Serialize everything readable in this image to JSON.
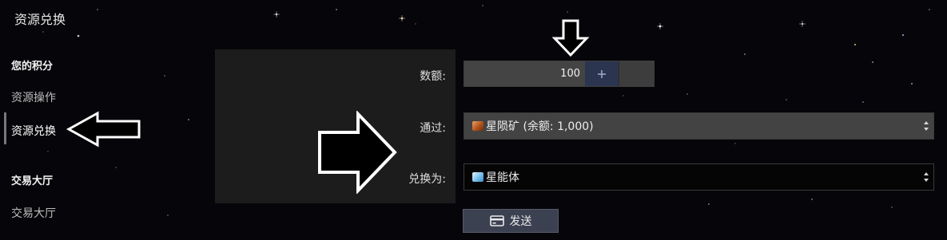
{
  "page": {
    "title": "资源兑换"
  },
  "sidebar": {
    "sections": [
      {
        "heading": "您的积分",
        "items": [
          {
            "label": "资源操作",
            "active": false
          },
          {
            "label": "资源兑换",
            "active": true
          }
        ]
      },
      {
        "heading": "交易大厅",
        "items": [
          {
            "label": "交易大厅",
            "active": false
          }
        ]
      }
    ]
  },
  "form": {
    "amount": {
      "label": "数额:",
      "value": "100",
      "increment_icon": "plus-icon"
    },
    "via": {
      "label": "通过:",
      "icon": "ore-icon",
      "selected": "星陨矿 (余额: 1,000)"
    },
    "to": {
      "label": "兑换为:",
      "icon": "crystal-icon",
      "selected": "星能体"
    },
    "submit": {
      "label": "发送",
      "icon": "card-icon"
    }
  },
  "colors": {
    "background": "#06060a",
    "panel": "#1e1e1e",
    "input": "#444444",
    "plus_button": "#2b3550",
    "send_button": "#3c4152",
    "annotation_arrow": "#ffffff"
  },
  "annotations": [
    {
      "icon": "arrow-down-icon",
      "points_to": "amount-field"
    },
    {
      "icon": "arrow-left-icon",
      "points_to": "sidebar-item-exchange"
    },
    {
      "icon": "arrow-right-icon",
      "points_to": "select-via"
    }
  ]
}
